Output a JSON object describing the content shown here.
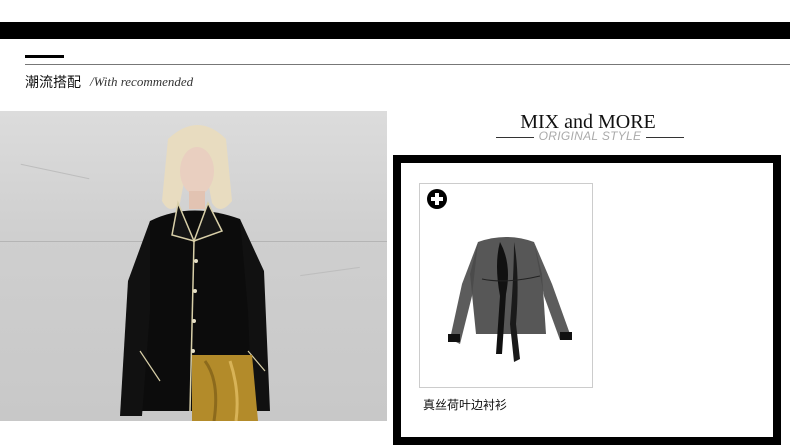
{
  "section": {
    "title": "潮流搭配",
    "subtitle": "/With recommended"
  },
  "mix": {
    "title": "MIX and MORE",
    "subtitle": "ORIGINAL STYLE"
  },
  "product": {
    "name": "真丝荷叶边衬衫",
    "add_icon": "plus-circle-icon"
  },
  "colors": {
    "accent": "#000000",
    "subtitle_gray": "#aaaaaa"
  }
}
